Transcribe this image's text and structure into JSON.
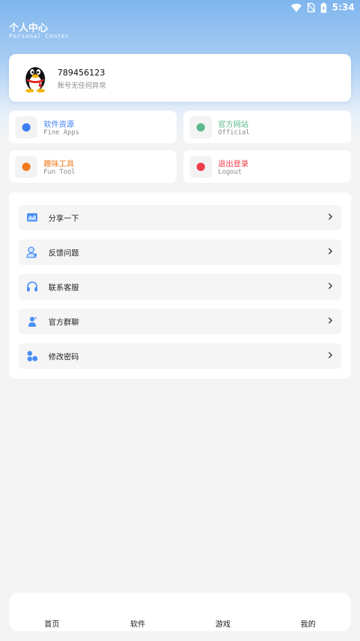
{
  "status_bar": {
    "time": "5:34"
  },
  "header": {
    "title": "个人中心",
    "subtitle": "Personal Center"
  },
  "profile": {
    "user_id": "789456123",
    "status": "账号无任何异常"
  },
  "quick_actions": [
    {
      "title": "软件资源",
      "subtitle": "Fine Apps",
      "color": "#3d7ff0"
    },
    {
      "title": "官方网站",
      "subtitle": "Official",
      "color": "#5bb88c"
    },
    {
      "title": "趣味工具",
      "subtitle": "Fun Tool",
      "color": "#f07a1c"
    },
    {
      "title": "退出登录",
      "subtitle": "Logout",
      "color": "#f03d4a"
    }
  ],
  "menu": [
    {
      "label": "分享一下",
      "icon": "share-icon"
    },
    {
      "label": "反馈问题",
      "icon": "feedback-icon"
    },
    {
      "label": "联系客服",
      "icon": "headphones-icon"
    },
    {
      "label": "官方群聊",
      "icon": "group-chat-icon"
    },
    {
      "label": "修改密码",
      "icon": "password-icon"
    }
  ],
  "bottom_nav": [
    {
      "label": "首页"
    },
    {
      "label": "软件"
    },
    {
      "label": "游戏"
    },
    {
      "label": "我的"
    }
  ],
  "colors": {
    "accent_blue": "#3d7ff0",
    "header_blue": "#7fb6ee"
  }
}
